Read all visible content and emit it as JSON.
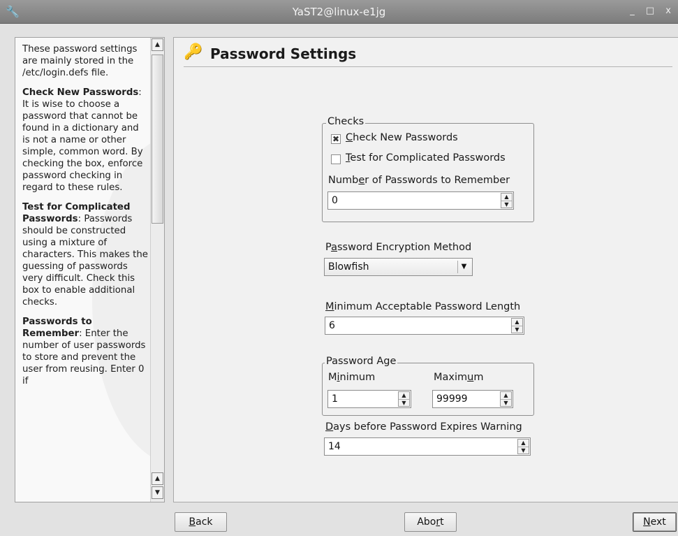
{
  "window": {
    "title": "YaST2@linux-e1jg",
    "controls": "_ □ x"
  },
  "help": {
    "p1": "These password settings are mainly stored in the /etc/login.defs file.",
    "p2_bold": "Check New Passwords",
    "p2_rest": ": It is wise to choose a password that cannot be found in a dictionary and is not a name or other simple, common word. By checking the box, enforce password checking in regard to these rules.",
    "p3_bold": "Test for Complicated Passwords",
    "p3_rest": ": Passwords should be constructed using a mixture of characters. This makes the guessing of passwords very difficult. Check this box to enable additional checks.",
    "p4_bold": "Passwords to Remember",
    "p4_rest": ": Enter the number of user passwords to store and prevent the user from reusing. Enter 0 if"
  },
  "header": {
    "title": "Password Settings"
  },
  "checks": {
    "legend": "Checks",
    "check_new": {
      "pre": "",
      "u": "C",
      "post": "heck New Passwords",
      "checked": true
    },
    "test_complicated": {
      "pre": "",
      "u": "T",
      "post": "est for Complicated Passwords",
      "checked": false
    },
    "remember_label": {
      "pre": "Numb",
      "u": "e",
      "post": "r of Passwords to Remember"
    },
    "remember_value": "0"
  },
  "encryption": {
    "label": {
      "pre": "P",
      "u": "a",
      "post": "ssword Encryption Method"
    },
    "value": "Blowfish"
  },
  "min_length": {
    "label": {
      "pre": "",
      "u": "M",
      "post": "inimum Acceptable Password Length"
    },
    "value": "6"
  },
  "age": {
    "legend": "Password Age",
    "min_label": {
      "pre": "M",
      "u": "i",
      "post": "nimum"
    },
    "max_label": {
      "pre": "Maxim",
      "u": "u",
      "post": "m"
    },
    "min_value": "1",
    "max_value": "99999"
  },
  "expire_warning": {
    "label": {
      "pre": "",
      "u": "D",
      "post": "ays before Password Expires Warning"
    },
    "value": "14"
  },
  "buttons": {
    "back": {
      "pre": "",
      "u": "B",
      "post": "ack"
    },
    "abort": {
      "pre": "Abo",
      "u": "r",
      "post": "t"
    },
    "next": {
      "pre": "",
      "u": "N",
      "post": "ext"
    }
  }
}
